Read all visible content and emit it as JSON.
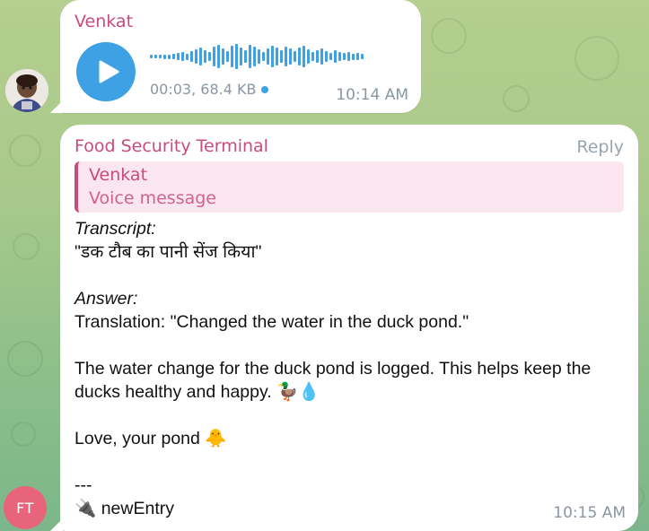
{
  "voice_message": {
    "sender": "Venkat",
    "duration": "00:03",
    "size": "68.4 KB",
    "meta": "00:03, 68.4 KB",
    "time": "10:14 AM",
    "unread": true
  },
  "bot_reply": {
    "sender": "Food Security Terminal",
    "reply_label": "Reply",
    "quote": {
      "name": "Venkat",
      "text": "Voice message"
    },
    "transcript_label": "Transcript:",
    "transcript_text": "\"डक टौब का पानी सेंज किया\"",
    "answer_label": "Answer:",
    "translation": "Translation: \"Changed the water in the duck pond.\"",
    "message": "The water change for the duck pond is logged. This helps keep the ducks healthy and happy. 🦆💧",
    "signoff": "Love, your pond 🐥",
    "separator": "---",
    "tag": "🔌 newEntry",
    "time": "10:15 AM"
  },
  "avatars": {
    "ft_initials": "FT",
    "ft_color": "#e8647b"
  },
  "colors": {
    "sender": "#c84b7e",
    "accent": "#3ea1e4",
    "muted": "#8a96a3",
    "quote_bg": "#fae6ee"
  }
}
